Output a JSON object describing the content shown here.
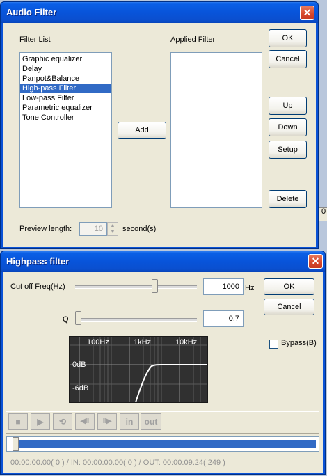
{
  "audio_filter": {
    "title": "Audio Filter",
    "close": "✕",
    "filter_list_label": "Filter List",
    "applied_filter_label": "Applied Filter",
    "filters": [
      "Graphic equalizer",
      "Delay",
      "Panpot&Balance",
      "High-pass Filter",
      "Low-pass Filter",
      "Parametric equalizer",
      "Tone Controller"
    ],
    "selected_index": 3,
    "add_label": "Add",
    "ok_label": "OK",
    "cancel_label": "Cancel",
    "up_label": "Up",
    "down_label": "Down",
    "setup_label": "Setup",
    "delete_label": "Delete",
    "preview_label": "Preview length:",
    "preview_value": "10",
    "preview_unit": "second(s)"
  },
  "background": {
    "right_edge_text": "0"
  },
  "highpass": {
    "title": "Highpass filter",
    "close": "✕",
    "cutoff_label": "Cut off Freq(Hz)",
    "cutoff_value": "1000",
    "cutoff_unit": "Hz",
    "q_label": "Q",
    "q_value": "0.7",
    "ok_label": "OK",
    "cancel_label": "Cancel",
    "bypass_label": "Bypass(B)",
    "bypass_checked": false,
    "graph": {
      "freq_labels": [
        "100Hz",
        "1kHz",
        "10kHz"
      ],
      "db_labels": [
        "0dB",
        "-6dB"
      ]
    },
    "transport": {
      "in_label": "in",
      "out_label": "out",
      "stop_icon": "■",
      "play_icon": "▶",
      "loop_icon": "⟲",
      "prev_icon": "◀‖",
      "next_icon": "‖▶"
    },
    "status_text": "00:00:00.00( 0 ) / IN: 00:00:00.00( 0 ) / OUT: 00:00:09.24( 249 )"
  },
  "colors": {
    "title_blue": "#0a54da",
    "selection": "#316ac5",
    "progress": "#316ac5",
    "graph_bg": "#303030"
  }
}
